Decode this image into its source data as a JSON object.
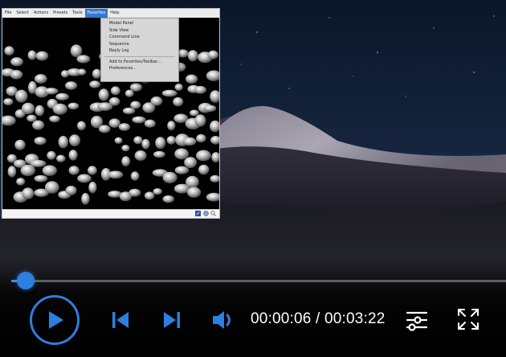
{
  "app_window": {
    "menu": [
      "File",
      "Select",
      "Actions",
      "Presets",
      "Tools",
      "Favorites",
      "Help"
    ],
    "active_menu": "Favorites",
    "favorites_items": [
      "Model Panel",
      "Side View",
      "Command Line",
      "Sequence",
      "Reply Log"
    ],
    "favorites_items_2": [
      "Add to Favorites/Toolbar...",
      "Preferences..."
    ]
  },
  "player": {
    "current_time": "00:00:06",
    "total_time": "00:03:22",
    "time_separator": "/",
    "progress": 0.03,
    "accent_color": "#2d7fe0"
  },
  "icons": {
    "play": "play-icon",
    "previous": "skip-previous-icon",
    "next": "skip-next-icon",
    "volume": "volume-icon",
    "settings": "sliders-icon",
    "fullscreen": "expand-icon"
  }
}
